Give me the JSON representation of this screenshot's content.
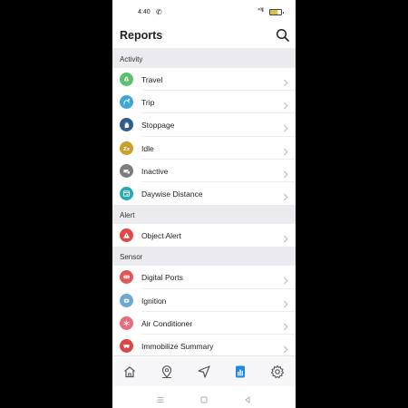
{
  "status_bar": {
    "time": "4:40",
    "signal_text": "⁴⁶ᴵll",
    "battery_level": 0.7
  },
  "header": {
    "title": "Reports",
    "search_icon": "search-icon"
  },
  "sections": [
    {
      "title": "Activity",
      "items": [
        {
          "label": "Travel",
          "icon": "travel-icon",
          "color": "#5cc16e"
        },
        {
          "label": "Trip",
          "icon": "trip-icon",
          "color": "#3fa6d2"
        },
        {
          "label": "Stoppage",
          "icon": "hand-icon",
          "color": "#2f5d8a"
        },
        {
          "label": "Idle",
          "icon": "idle-icon",
          "color": "#c9a02a"
        },
        {
          "label": "Inactive",
          "icon": "inactive-icon",
          "color": "#7d7d7d"
        },
        {
          "label": "Daywise Distance",
          "icon": "daywise-distance-icon",
          "color": "#25a9b2"
        }
      ]
    },
    {
      "title": "Alert",
      "items": [
        {
          "label": "Object Alert",
          "icon": "warning-icon",
          "color": "#e04848"
        }
      ]
    },
    {
      "title": "Sensor",
      "items": [
        {
          "label": "Digital Ports",
          "icon": "digital-ports-icon",
          "color": "#e15858"
        },
        {
          "label": "Ignition",
          "icon": "ignition-icon",
          "color": "#6fa8cf"
        },
        {
          "label": "Air Conditioner",
          "icon": "air-conditioner-icon",
          "color": "#e86b7f"
        },
        {
          "label": "Immobilize Summary",
          "icon": "immobilize-icon",
          "color": "#d94747"
        }
      ]
    }
  ],
  "bottom_nav": [
    {
      "name": "home-icon",
      "active": false
    },
    {
      "name": "map-pin-icon",
      "active": false
    },
    {
      "name": "navigation-icon",
      "active": false
    },
    {
      "name": "reports-icon",
      "active": true
    },
    {
      "name": "settings-icon",
      "active": false
    }
  ],
  "colors": {
    "accent": "#1e88e5",
    "inactive": "#555555"
  }
}
